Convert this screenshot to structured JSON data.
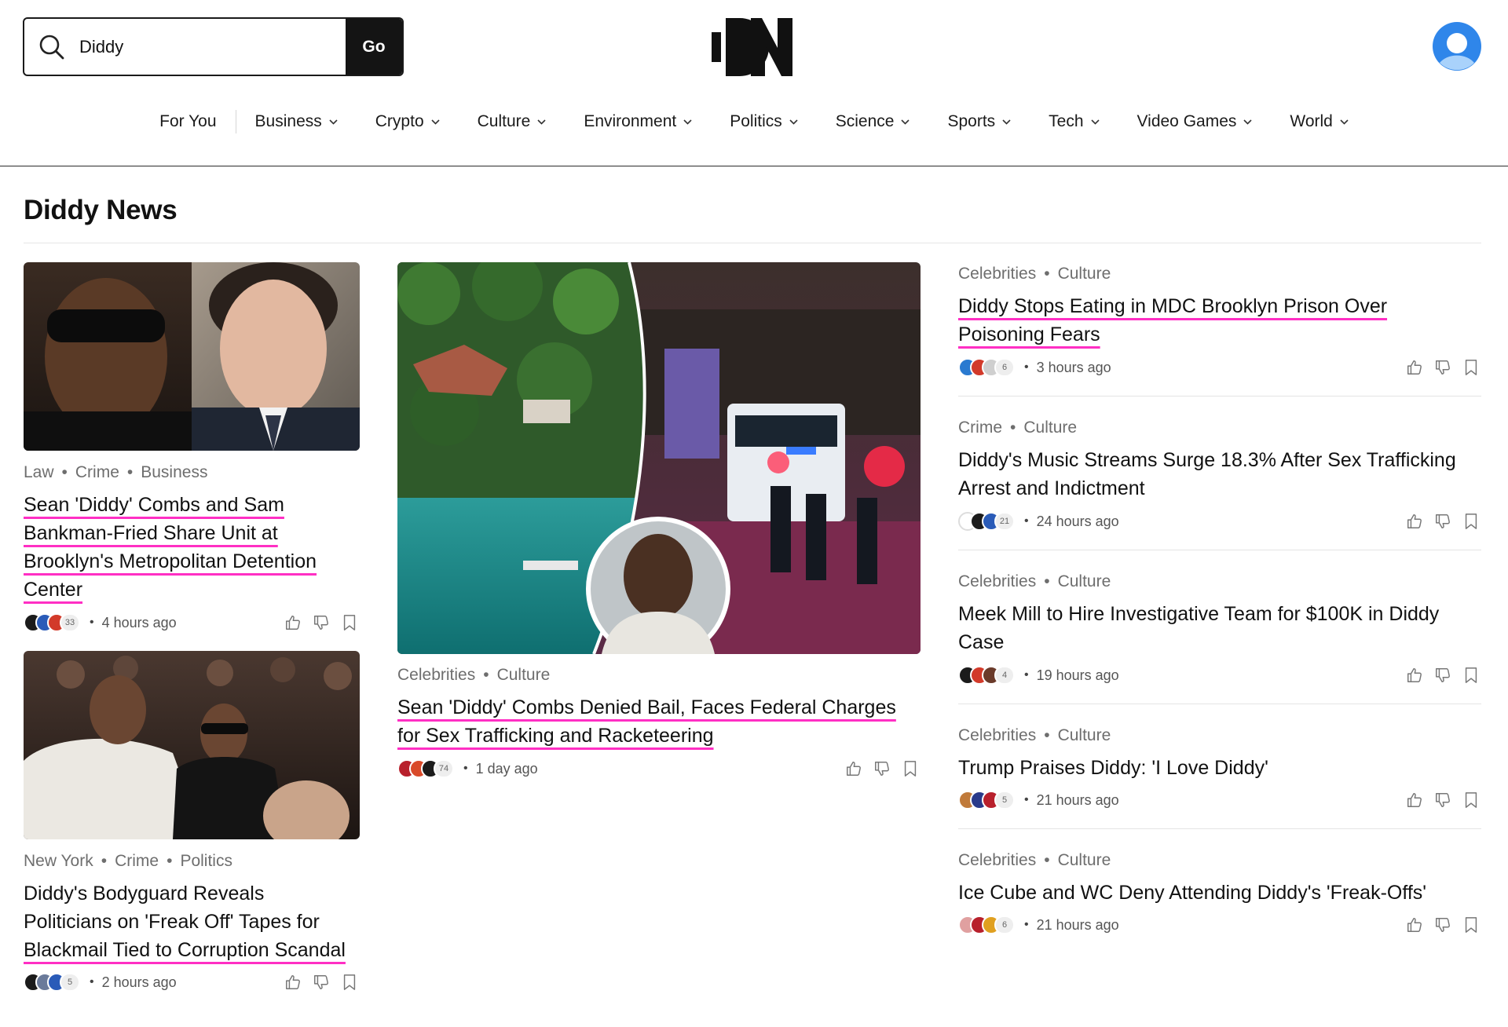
{
  "search": {
    "value": "Diddy",
    "go_label": "Go"
  },
  "nav": [
    {
      "label": "For You",
      "dropdown": false
    },
    {
      "label": "Business",
      "dropdown": true
    },
    {
      "label": "Crypto",
      "dropdown": true
    },
    {
      "label": "Culture",
      "dropdown": true
    },
    {
      "label": "Environment",
      "dropdown": true
    },
    {
      "label": "Politics",
      "dropdown": true
    },
    {
      "label": "Science",
      "dropdown": true
    },
    {
      "label": "Sports",
      "dropdown": true
    },
    {
      "label": "Tech",
      "dropdown": true
    },
    {
      "label": "Video Games",
      "dropdown": true
    },
    {
      "label": "World",
      "dropdown": true
    }
  ],
  "page_title": "Diddy News",
  "colors": {
    "accent_underline": "#ff2fc4",
    "go_button": "#141414",
    "avatar": "#2f86ea"
  },
  "articles": {
    "left1": {
      "tags": [
        "Law",
        "Crime",
        "Business"
      ],
      "title_lines": [
        "Sean 'Diddy' Combs and Sam",
        "Bankman-Fried Share Unit at",
        "Brooklyn's Metropolitan Detention",
        "Center"
      ],
      "count": "33",
      "time": "4 hours ago"
    },
    "left2": {
      "tags": [
        "New York",
        "Crime",
        "Politics"
      ],
      "title_lines": [
        "Diddy's Bodyguard Reveals",
        "Politicians on 'Freak Off' Tapes for",
        "Blackmail Tied to Corruption Scandal"
      ],
      "count": "5",
      "time": "2 hours ago"
    },
    "center": {
      "tags": [
        "Celebrities",
        "Culture"
      ],
      "title_lines": [
        "Sean 'Diddy' Combs Denied Bail, Faces Federal Charges",
        "for Sex Trafficking and Racketeering"
      ],
      "count": "74",
      "time": "1 day ago"
    },
    "right": [
      {
        "tags": [
          "Celebrities",
          "Culture"
        ],
        "title_lines": [
          "Diddy Stops Eating in MDC Brooklyn Prison Over",
          "Poisoning Fears"
        ],
        "count": "6",
        "time": "3 hours ago"
      },
      {
        "tags": [
          "Crime",
          "Culture"
        ],
        "title_lines": [
          "Diddy's Music Streams Surge 18.3% After Sex Trafficking",
          "Arrest and Indictment"
        ],
        "count": "21",
        "time": "24 hours ago"
      },
      {
        "tags": [
          "Celebrities",
          "Culture"
        ],
        "title_lines": [
          "Meek Mill to Hire Investigative Team for $100K in Diddy",
          "Case"
        ],
        "count": "4",
        "time": "19 hours ago"
      },
      {
        "tags": [
          "Celebrities",
          "Culture"
        ],
        "title_lines": [
          "Trump Praises Diddy: 'I Love Diddy'"
        ],
        "count": "5",
        "time": "21 hours ago"
      },
      {
        "tags": [
          "Celebrities",
          "Culture"
        ],
        "title_lines": [
          "Ice Cube and WC Deny Attending Diddy's 'Freak-Offs'"
        ],
        "count": "6",
        "time": "21 hours ago"
      }
    ]
  }
}
